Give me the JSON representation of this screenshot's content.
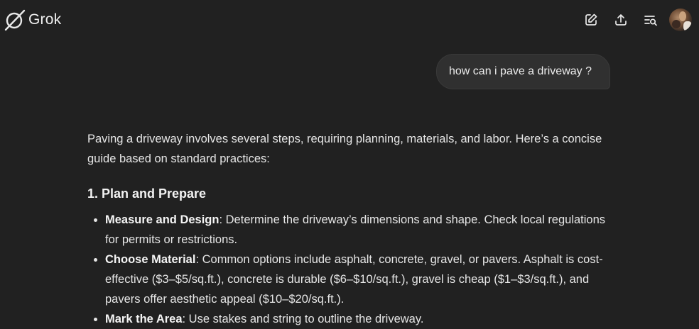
{
  "header": {
    "app_name": "Grok",
    "icons": [
      "new-chat-icon",
      "share-icon",
      "search-history-icon"
    ]
  },
  "conversation": {
    "user_message": "how can i pave a driveway ?",
    "intro": "Paving a driveway involves several steps, requiring planning, materials, and labor. Here’s a concise guide based on standard practices:",
    "section_title": "1. Plan and Prepare",
    "bullets": [
      {
        "term": "Measure and Design",
        "text": ": Determine the driveway’s dimensions and shape. Check local regulations for permits or restrictions."
      },
      {
        "term": "Choose Material",
        "text": ": Common options include asphalt, concrete, gravel, or pavers. Asphalt is cost-effective ($3–$5/sq.ft.), concrete is durable ($6–$10/sq.ft.), gravel is cheap ($1–$3/sq.ft.), and pavers offer aesthetic appeal ($10–$20/sq.ft.)."
      },
      {
        "term": "Mark the Area",
        "text": ": Use stakes and string to outline the driveway."
      }
    ]
  },
  "colors": {
    "background": "#212121",
    "bubble": "#303030",
    "text": "#e6e6e6"
  }
}
